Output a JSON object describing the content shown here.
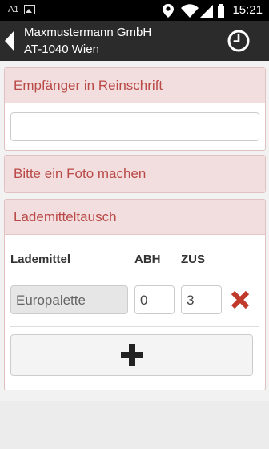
{
  "statusbar": {
    "carrier": "A1",
    "time": "15:21",
    "icons": [
      "image-icon",
      "location-icon",
      "wifi-icon",
      "signal-icon",
      "battery-icon"
    ]
  },
  "header": {
    "title_line1": "Maxmustermann GmbH",
    "title_line2": "AT-1040 Wien",
    "icons": [
      "back-icon",
      "clock-icon"
    ]
  },
  "recipient": {
    "heading": "Empfänger in Reinschrift",
    "value": ""
  },
  "photo": {
    "heading": "Bitte ein Foto machen"
  },
  "exchange": {
    "heading": "Lademitteltausch",
    "columns": [
      "Lademittel",
      "ABH",
      "ZUS"
    ],
    "rows": [
      {
        "lademittel": "Europalette",
        "abh": "0",
        "zus": "3"
      }
    ],
    "icons": [
      "delete-icon",
      "plus-icon"
    ]
  },
  "colors": {
    "panel_heading_bg": "#f2dede",
    "panel_heading_text": "#b94a48",
    "delete": "#c0392b",
    "header_bg": "#2b2b2b"
  }
}
